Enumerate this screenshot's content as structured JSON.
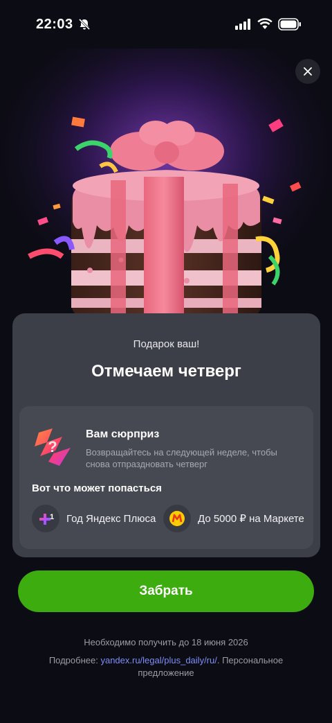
{
  "status": {
    "time": "22:03"
  },
  "hero": {
    "image_alt": "cake-gift"
  },
  "card": {
    "gift_label": "Подарок ваш!",
    "title": "Отмечаем четверг",
    "surprise": {
      "title": "Вам сюрприз",
      "text": "Возвращайтесь на следующей неделе, чтобы снова отпраздновать четверг"
    },
    "may_get": "Вот что может попасться",
    "rewards": [
      {
        "label": "Год Яндекс Плюса",
        "icon": "plus-logo-icon"
      },
      {
        "label": "До 5000 ₽ на Маркете",
        "icon": "market-logo-icon"
      }
    ]
  },
  "cta": {
    "label": "Забрать"
  },
  "footer": {
    "deadline": "Необходимо получить до 18 июня 2026",
    "more_prefix": "Подробнее: ",
    "more_link": "yandex.ru/legal/plus_daily/ru/",
    "more_suffix": ". Персональное предложение"
  },
  "colors": {
    "background": "#0c0c14",
    "card": "#3d3f48",
    "inner_card": "#464852",
    "cta": "#3cac0f",
    "link": "#7f8ef8"
  }
}
